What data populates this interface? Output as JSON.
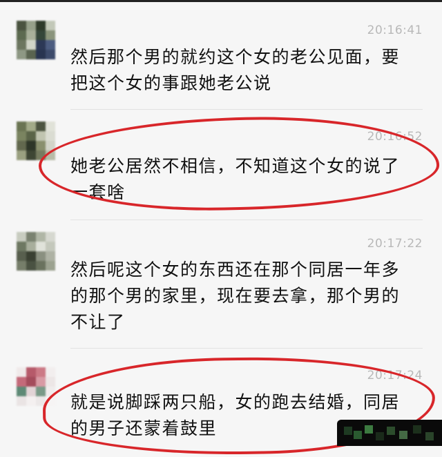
{
  "messages": [
    {
      "time": "20:16:41",
      "text": "然后那个男的就约这个女的老公见面，要把这个女的事跟她老公说"
    },
    {
      "time": "20:16:52",
      "text": "她老公居然不相信，不知道这个女的说了一套啥"
    },
    {
      "time": "20:17:22",
      "text": "然后呢这个女的东西还在那个同居一年多的那个男的家里，现在要去拿，那个男的不让了"
    },
    {
      "time": "20:17:24",
      "text": "就是说脚踩两只船，女的跑去结婚，同居的男子还蒙着鼓里"
    }
  ],
  "colors": {
    "background": "#f6f6f6",
    "message_text": "#111111",
    "timestamp": "#b8b8b8",
    "annotation_circle": "#d8262a"
  },
  "icons": {
    "avatar": "pixelated-avatar-icon"
  }
}
